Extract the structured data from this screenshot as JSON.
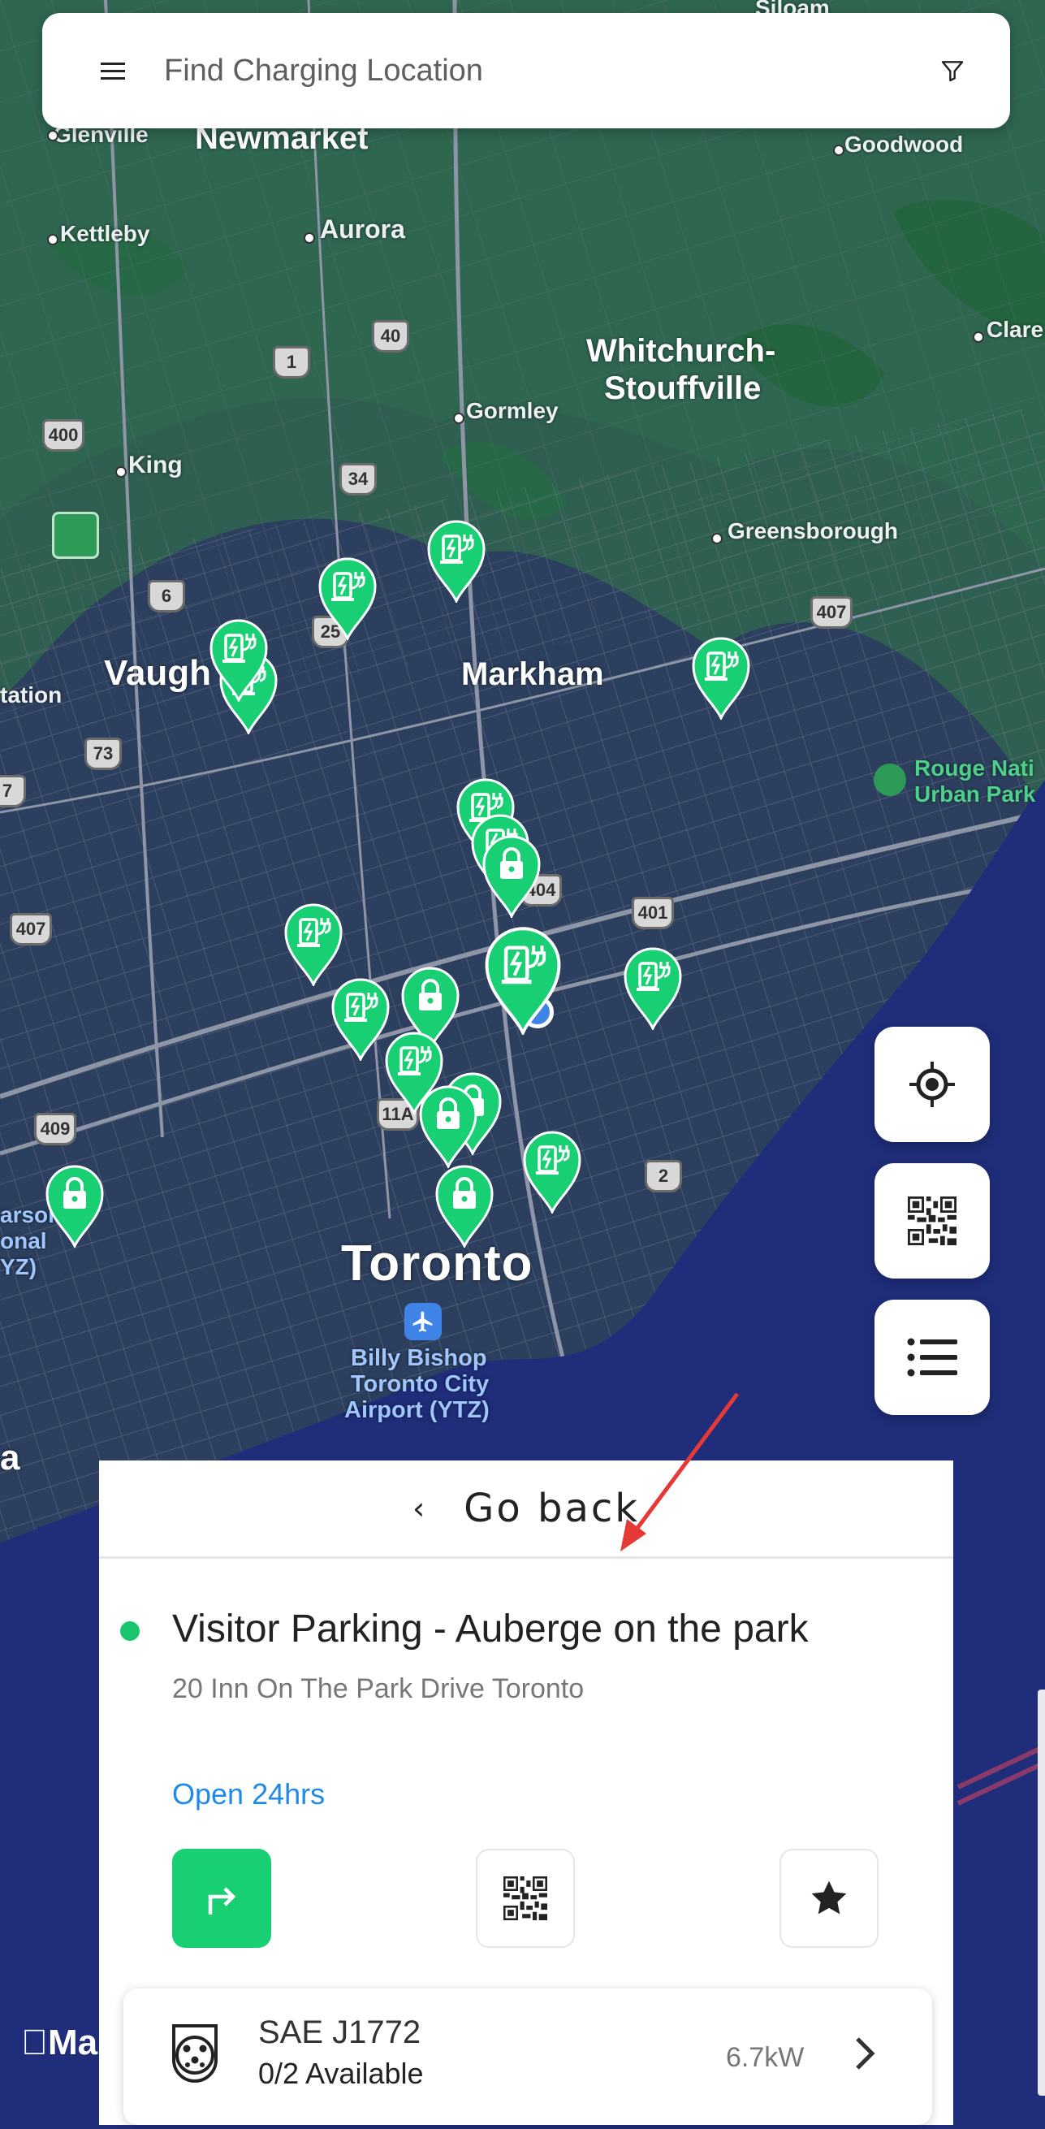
{
  "search": {
    "placeholder": "Find Charging Location"
  },
  "map": {
    "places": [
      {
        "key": "siloam",
        "text": "Siloam"
      },
      {
        "key": "glenville",
        "text": "Glenville"
      },
      {
        "key": "newmarket",
        "text": "Newmarket"
      },
      {
        "key": "goodwood",
        "text": "Goodwood"
      },
      {
        "key": "kettleby",
        "text": "Kettleby"
      },
      {
        "key": "aurora",
        "text": "Aurora"
      },
      {
        "key": "clare",
        "text": "Clare"
      },
      {
        "key": "whitchurch1",
        "text": "Whitchurch-"
      },
      {
        "key": "whitchurch2",
        "text": "Stouffville"
      },
      {
        "key": "gormley",
        "text": "Gormley"
      },
      {
        "key": "king",
        "text": "King"
      },
      {
        "key": "greensborough",
        "text": "Greensborough"
      },
      {
        "key": "vaughan",
        "text": "Vaugh"
      },
      {
        "key": "markham",
        "text": "Markham"
      },
      {
        "key": "station",
        "text": "tation"
      },
      {
        "key": "rouge1",
        "text": "Rouge Nati"
      },
      {
        "key": "rouge2",
        "text": "Urban Park"
      },
      {
        "key": "toronto",
        "text": "Toronto"
      },
      {
        "key": "pearson1",
        "text": "arson"
      },
      {
        "key": "pearson2",
        "text": "onal"
      },
      {
        "key": "pearson3",
        "text": "YZ)"
      },
      {
        "key": "airport1",
        "text": "Billy Bishop"
      },
      {
        "key": "airport2",
        "text": "Toronto City"
      },
      {
        "key": "airport3",
        "text": "Airport (YTZ)"
      },
      {
        "key": "a",
        "text": "a"
      }
    ],
    "highways": [
      "40",
      "1",
      "400",
      "34",
      "6",
      "25",
      "407",
      "73",
      "404",
      "401",
      "407",
      "409",
      "11A",
      "2",
      "7"
    ],
    "brand": "Ma"
  },
  "controls": {
    "locate_icon": "crosshair-icon",
    "qr_icon": "qr-code-icon",
    "list_icon": "list-icon"
  },
  "sheet": {
    "back_label": "Go back",
    "location_name": "Visitor Parking - Auberge on the park",
    "address": "20 Inn On The Park Drive Toronto",
    "hours": "Open 24hrs",
    "status_color": "#19c66e",
    "connector": {
      "name": "SAE J1772",
      "availability": "0/2 Available",
      "power": "6.7kW"
    }
  },
  "colors": {
    "accent_green": "#19cf74",
    "link_blue": "#1f8ae8",
    "water": "#1f2d7a",
    "annotation_arrow": "#e53935"
  }
}
